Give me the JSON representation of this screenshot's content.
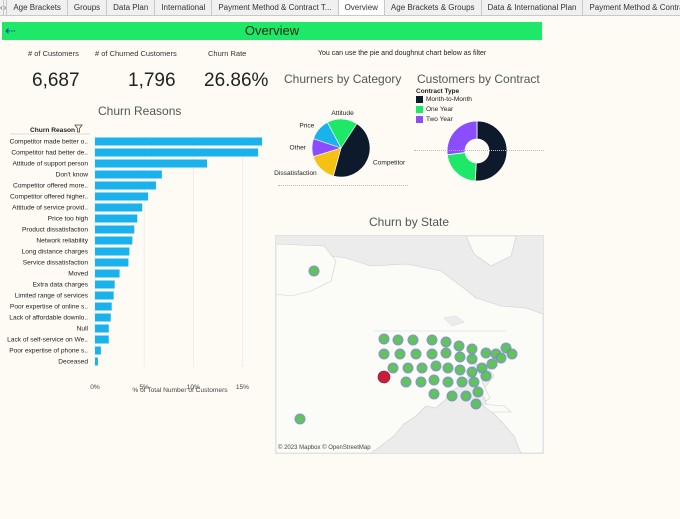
{
  "tabs": [
    {
      "label": "Age Brackets",
      "active": false
    },
    {
      "label": "Groups",
      "active": false
    },
    {
      "label": "Data Plan",
      "active": false
    },
    {
      "label": "International",
      "active": false
    },
    {
      "label": "Payment Method & Contract T...",
      "active": false
    },
    {
      "label": "Overview",
      "active": true
    },
    {
      "label": "Age Brackets & Groups",
      "active": false
    },
    {
      "label": "Data & International Plan",
      "active": false
    },
    {
      "label": "Payment Method & Contract T...",
      "active": false
    }
  ],
  "nav": {
    "prev": "‹",
    "next": "›"
  },
  "header": {
    "title": "Overview",
    "back_icon": "back-arrow-icon"
  },
  "kpis": {
    "customers": {
      "label": "# of Customers",
      "value": "6,687"
    },
    "churned": {
      "label": "# of Churned Customers",
      "value": "1,796"
    },
    "churn_rate": {
      "label": "Churn Rate",
      "value": "26.86%"
    }
  },
  "filter_note": "You can use the pie and doughnut chart below as filter",
  "churn_reasons": {
    "title": "Churn Reasons",
    "header": "Churn Reason",
    "filter_icon": "filter-icon",
    "xlabel": "% of Total Number of Customers",
    "chart_data": {
      "type": "bar",
      "orientation": "horizontal",
      "categories": [
        "Competitor made better o..",
        "Competitor had better de..",
        "Attitude of support person",
        "Don't know",
        "Competitor offered more..",
        "Competitor offered higher..",
        "Attitude of service provid..",
        "Price too high",
        "Product dissatisfaction",
        "Network reliability",
        "Long distance charges",
        "Service dissatisfaction",
        "Moved",
        "Extra data charges",
        "Limited range of services",
        "Poor expertise of online s..",
        "Lack of affordable downlo..",
        "Null",
        "Lack of self-service on We..",
        "Poor expertise of phone s..",
        "Deceased"
      ],
      "values": [
        17.0,
        16.6,
        11.4,
        6.8,
        6.2,
        5.4,
        4.8,
        4.3,
        4.0,
        3.8,
        3.5,
        3.4,
        2.5,
        2.0,
        1.9,
        1.7,
        1.6,
        1.4,
        1.4,
        0.6,
        0.3
      ],
      "xlim": [
        0,
        17.5
      ],
      "xticks": [
        "0%",
        "5%",
        "10%",
        "15%"
      ],
      "xtick_values": [
        0,
        5,
        10,
        15
      ],
      "color": "#1ab2ec"
    }
  },
  "churners_by_category": {
    "title": "Churners by Category",
    "chart_data": {
      "type": "pie",
      "labels": [
        "Attitude",
        "Competitor",
        "Dissatisfaction",
        "Other",
        "Price"
      ],
      "values": [
        17,
        45,
        16,
        10,
        12
      ],
      "colors": [
        "#1ee867",
        "#0d1a2b",
        "#f5c112",
        "#8a4dff",
        "#1ab2ec"
      ]
    }
  },
  "customers_by_contract": {
    "title": "Customers by Contract",
    "legend_title": "Contract Type",
    "chart_data": {
      "type": "pie",
      "donut": true,
      "labels": [
        "Month-to-Month",
        "One Year",
        "Two Year"
      ],
      "values": [
        51,
        22,
        27
      ],
      "colors": [
        "#0d1a2b",
        "#1ee867",
        "#8a4dff"
      ]
    }
  },
  "churn_by_state": {
    "title": "Churn by State",
    "credit": "© 2023 Mapbox © OpenStreetMap"
  }
}
